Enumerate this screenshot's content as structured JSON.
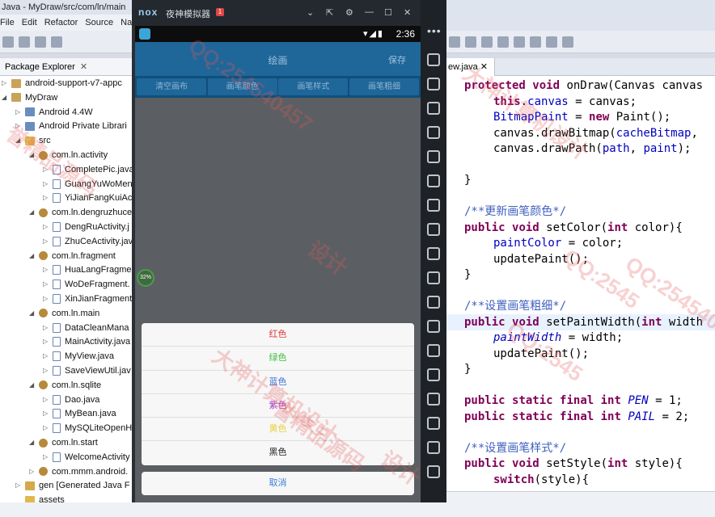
{
  "eclipse": {
    "title": "Java - MyDraw/src/com/ln/main",
    "menu": [
      "File",
      "Edit",
      "Refactor",
      "Source",
      "Na"
    ],
    "package_explorer_label": "Package Explorer",
    "tree": [
      {
        "label": "android-support-v7-appc",
        "indent": 0,
        "icon": "project-icon",
        "tw": "▷"
      },
      {
        "label": "MyDraw",
        "indent": 0,
        "icon": "project-icon",
        "tw": "◢"
      },
      {
        "label": "Android 4.4W",
        "indent": 1,
        "icon": "library-icon",
        "tw": "▷"
      },
      {
        "label": "Android Private Librari",
        "indent": 1,
        "icon": "library-icon",
        "tw": "▷"
      },
      {
        "label": "src",
        "indent": 1,
        "icon": "folder-icon",
        "tw": "◢"
      },
      {
        "label": "com.ln.activity",
        "indent": 2,
        "icon": "package-icon",
        "tw": "◢"
      },
      {
        "label": "CompletePic.java",
        "indent": 3,
        "icon": "java-file-icon",
        "tw": "▷"
      },
      {
        "label": "GuangYuWoMen",
        "indent": 3,
        "icon": "java-file-icon",
        "tw": "▷"
      },
      {
        "label": "YiJianFangKuiAct",
        "indent": 3,
        "icon": "java-file-icon",
        "tw": "▷"
      },
      {
        "label": "com.ln.dengruzhuce",
        "indent": 2,
        "icon": "package-icon",
        "tw": "◢"
      },
      {
        "label": "DengRuActivity.j",
        "indent": 3,
        "icon": "java-file-icon",
        "tw": "▷"
      },
      {
        "label": "ZhuCeActivity.jav",
        "indent": 3,
        "icon": "java-file-icon",
        "tw": "▷"
      },
      {
        "label": "com.ln.fragment",
        "indent": 2,
        "icon": "package-icon",
        "tw": "◢"
      },
      {
        "label": "HuaLangFragme",
        "indent": 3,
        "icon": "java-file-icon",
        "tw": "▷"
      },
      {
        "label": "WoDeFragment.",
        "indent": 3,
        "icon": "java-file-icon",
        "tw": "▷"
      },
      {
        "label": "XinJianFragment",
        "indent": 3,
        "icon": "java-file-icon",
        "tw": "▷"
      },
      {
        "label": "com.ln.main",
        "indent": 2,
        "icon": "package-icon",
        "tw": "◢"
      },
      {
        "label": "DataCleanMana",
        "indent": 3,
        "icon": "java-file-icon",
        "tw": "▷"
      },
      {
        "label": "MainActivity.java",
        "indent": 3,
        "icon": "java-file-icon",
        "tw": "▷"
      },
      {
        "label": "MyView.java",
        "indent": 3,
        "icon": "java-file-icon",
        "tw": "▷"
      },
      {
        "label": "SaveViewUtil.jav",
        "indent": 3,
        "icon": "java-file-icon",
        "tw": "▷"
      },
      {
        "label": "com.ln.sqlite",
        "indent": 2,
        "icon": "package-icon",
        "tw": "◢"
      },
      {
        "label": "Dao.java",
        "indent": 3,
        "icon": "java-file-icon",
        "tw": "▷"
      },
      {
        "label": "MyBean.java",
        "indent": 3,
        "icon": "java-file-icon",
        "tw": "▷"
      },
      {
        "label": "MySQLiteOpenH",
        "indent": 3,
        "icon": "java-file-icon",
        "tw": "▷"
      },
      {
        "label": "com.ln.start",
        "indent": 2,
        "icon": "package-icon",
        "tw": "◢"
      },
      {
        "label": "WelcomeActivity",
        "indent": 3,
        "icon": "java-file-icon",
        "tw": "▷"
      },
      {
        "label": "com.mmm.android.",
        "indent": 2,
        "icon": "package-icon",
        "tw": "▷"
      },
      {
        "label": "gen [Generated Java F",
        "indent": 1,
        "icon": "gen-folder-icon",
        "tw": "▷"
      },
      {
        "label": "assets",
        "indent": 1,
        "icon": "folder-icon",
        "tw": ""
      }
    ],
    "editor_tab": "ew.java",
    "code_lines": [
      {
        "html": "<span class=\"kw\">protected</span> <span class=\"kw\">void</span> onDraw(Canvas canvas",
        "indent": 0
      },
      {
        "html": "<span class=\"kw\">this</span>.<span class=\"fld\">canvas</span> = canvas;",
        "indent": 1
      },
      {
        "html": "<span class=\"fld\">BitmapPaint</span> = <span class=\"kw\">new</span> Paint();",
        "indent": 1
      },
      {
        "html": "canvas.drawBitmap(<span class=\"fld\">cacheBitmap</span>,",
        "indent": 1
      },
      {
        "html": "canvas.drawPath(<span class=\"fld\">path</span>, <span class=\"fld\">paint</span>);",
        "indent": 1
      },
      {
        "html": "",
        "indent": 0
      },
      {
        "html": "}",
        "indent": 0
      },
      {
        "html": "",
        "indent": 0
      },
      {
        "html": "<span class=\"cmt\">/**更新画笔颜色*/</span>",
        "indent": 0
      },
      {
        "html": "<span class=\"kw\">public</span> <span class=\"kw\">void</span> setColor(<span class=\"kw\">int</span> color){",
        "indent": 0
      },
      {
        "html": "<span class=\"fld\">paintColor</span> = color;",
        "indent": 1
      },
      {
        "html": "updatePaint();",
        "indent": 1
      },
      {
        "html": "}",
        "indent": 0
      },
      {
        "html": "",
        "indent": 0
      },
      {
        "html": "<span class=\"cmt\">/**设置画笔粗细*/</span>",
        "indent": 0
      },
      {
        "html": "<span class=\"kw\">public</span> <span class=\"kw\">void</span> setPaintWidth(<span class=\"kw\">int</span> width",
        "indent": 0,
        "hl": true
      },
      {
        "html": "<span class=\"fld-i\">paintWidth</span> = width;",
        "indent": 1
      },
      {
        "html": "updatePaint();",
        "indent": 1
      },
      {
        "html": "}",
        "indent": 0
      },
      {
        "html": "",
        "indent": 0
      },
      {
        "html": "<span class=\"kw\">public</span> <span class=\"kw\">static</span> <span class=\"kw\">final</span> <span class=\"kw\">int</span> <span class=\"fld-i\">PEN</span> = 1;",
        "indent": 0
      },
      {
        "html": "<span class=\"kw\">public</span> <span class=\"kw\">static</span> <span class=\"kw\">final</span> <span class=\"kw\">int</span> <span class=\"fld-i\">PAIL</span> = 2;",
        "indent": 0
      },
      {
        "html": "",
        "indent": 0
      },
      {
        "html": "<span class=\"cmt\">/**设置画笔样式*/</span>",
        "indent": 0
      },
      {
        "html": "<span class=\"kw\">public</span> <span class=\"kw\">void</span> setStyle(<span class=\"kw\">int</span> style){",
        "indent": 0
      },
      {
        "html": "<span class=\"kw\">switch</span>(style){",
        "indent": 1
      }
    ]
  },
  "emulator": {
    "logo": "nox",
    "name": "夜神模拟器",
    "badge": "1",
    "controls": [
      "⌄",
      "⇱",
      "⚙",
      "—",
      "☐",
      "✕"
    ],
    "status_time": "2:36",
    "status_icons": "▾◢▮",
    "app_title": "绘画",
    "save_label": "保存",
    "buttons": [
      "清空画布",
      "画笔颜色",
      "画笔样式",
      "画笔粗细"
    ],
    "progress_label": "32%",
    "colors": [
      {
        "label": "红色",
        "color": "#e03a3a"
      },
      {
        "label": "绿色",
        "color": "#3fbf3f"
      },
      {
        "label": "蓝色",
        "color": "#3a6fe0"
      },
      {
        "label": "紫色",
        "color": "#a23fd0"
      },
      {
        "label": "黄色",
        "color": "#e8d23a"
      },
      {
        "label": "黑色",
        "color": "#222222"
      }
    ],
    "cancel_label": "取消",
    "side_dots": "•••"
  },
  "watermarks": [
    "QQ:254540457",
    "大神计算机设计",
    "誉精品源码",
    "设计",
    "QQ:2545"
  ]
}
